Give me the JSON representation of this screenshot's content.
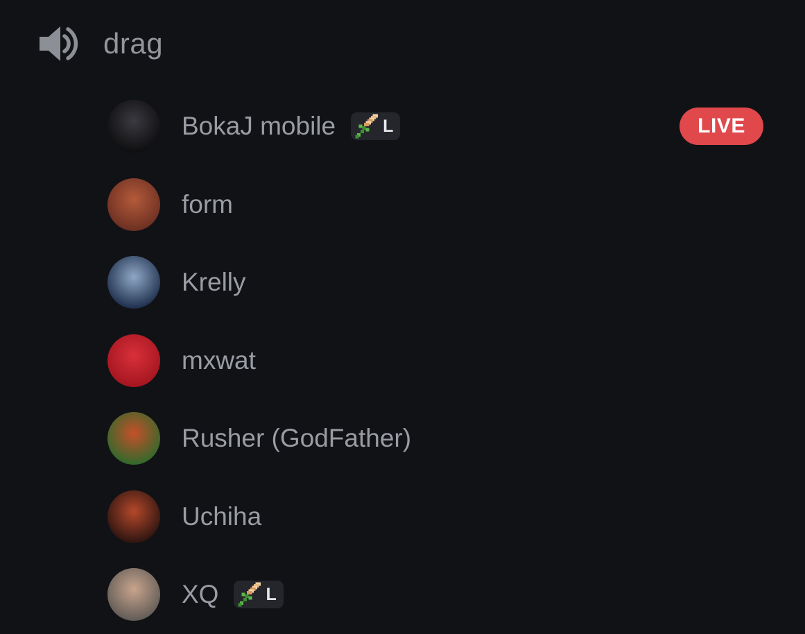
{
  "channel": {
    "icon": "speaker-volume-icon",
    "name": "drag"
  },
  "colors": {
    "background": "#111216",
    "text_muted": "#9a9ca4",
    "live": "#e0484c",
    "badge_bg": "#24262c"
  },
  "members": [
    {
      "name": "BokaJ mobile",
      "tag": {
        "icon": "sword-icon",
        "label": "L"
      },
      "live": "LIVE",
      "avatar_colors": [
        "#0d0d0f",
        "#3a3a40"
      ]
    },
    {
      "name": "form",
      "avatar_colors": [
        "#6b2f22",
        "#b45a3a"
      ]
    },
    {
      "name": "Krelly",
      "avatar_colors": [
        "#1c2d4a",
        "#8fa8c6"
      ]
    },
    {
      "name": "mxwat",
      "avatar_colors": [
        "#a3151f",
        "#d8303a"
      ]
    },
    {
      "name": "Rusher (GodFather)",
      "avatar_colors": [
        "#2e6a2b",
        "#c5502a"
      ]
    },
    {
      "name": "Uchiha",
      "avatar_colors": [
        "#2a1410",
        "#b5482a"
      ]
    },
    {
      "name": "XQ",
      "tag": {
        "icon": "sword-icon",
        "label": "L"
      },
      "avatar_colors": [
        "#5f5a55",
        "#c8a48d"
      ]
    }
  ]
}
